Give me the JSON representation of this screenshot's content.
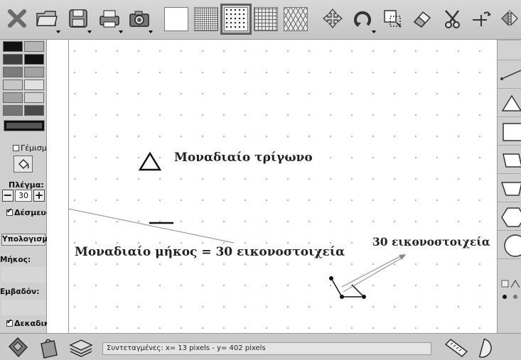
{
  "toolbar": {
    "buttons": [
      "close-icon",
      "open-folder-icon",
      "save-icon",
      "print-icon",
      "camera-icon"
    ],
    "grid_modes": [
      "blank",
      "fine-dots",
      "dotted",
      "square-grid",
      "triangular-grid"
    ],
    "selected_grid_mode": "dotted",
    "tools": [
      "move-icon",
      "rotate-icon",
      "crop-icon",
      "eraser-icon",
      "scissors-icon",
      "vector-icon",
      "flip-icon"
    ]
  },
  "left_panel": {
    "colors": [
      "#111111",
      "#b5b5b5",
      "#3e3e3e",
      "#111111",
      "#7b7b7b",
      "#a3a3a3",
      "#c6c6c6",
      "#e0e0e0",
      "#a3a3a3",
      "#d3d3d3",
      "#747474",
      "#4a4a4a"
    ],
    "fill_label": "Γέμισμα",
    "grid_label": "Πλέγμα:",
    "grid_value": "30",
    "snap_label": "Δέσμευση",
    "calculations_label": "Υπολογισμοί",
    "length_label": "Μήκος:",
    "area_label": "Εμβαδόν:",
    "decimals_label": "Δεκαδικά"
  },
  "canvas": {
    "unit_triangle_label": "Μοναδιαίο τρίγωνο",
    "unit_length_label": "Μοναδιαίο μήκος = 30 εικονοστοιχεία",
    "pixels_label": "30 εικονοστοιχεία"
  },
  "right_panel": {
    "shapes": [
      "line-icon",
      "triangle-icon",
      "square-icon",
      "parallelogram-icon",
      "trapezoid-icon",
      "hexagon-icon",
      "circle-icon"
    ]
  },
  "status": {
    "coordinates": "Συντεταγμένες:  x= 13 pixels  -  y= 402 pixels"
  }
}
